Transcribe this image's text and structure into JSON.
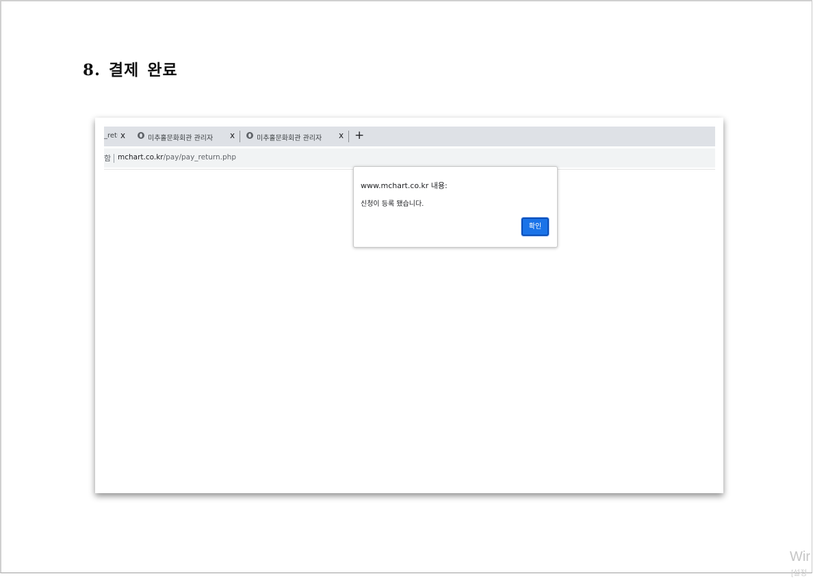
{
  "document": {
    "heading": "8. 결제 완료"
  },
  "screenshot": {
    "tabs": [
      {
        "title": "_retu",
        "close": "x"
      },
      {
        "title": "미추홀문화회관 관리자",
        "close": "x",
        "icon": "globe-icon"
      },
      {
        "title": "미추홀문화회관 관리자",
        "close": "x",
        "icon": "globe-icon"
      }
    ],
    "new_tab": "+",
    "address": {
      "secure_label": "함",
      "domain": "mchart.co.kr",
      "path": "/pay/pay_return.php"
    },
    "dialog": {
      "title": "www.mchart.co.kr 내용:",
      "message": "신청이 등록 됐습니다.",
      "ok_label": "확인",
      "button_color": "#1a73e8"
    }
  },
  "watermark": {
    "text": "Wir",
    "subtext": "[설정"
  }
}
